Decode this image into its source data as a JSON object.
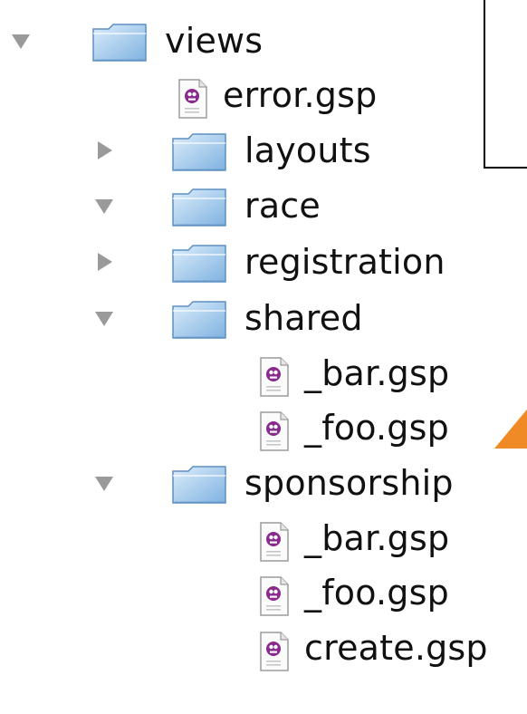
{
  "colors": {
    "folder_light": "#dcedfb",
    "folder_dark": "#7fb2e0",
    "folder_stroke": "#5d8fc2",
    "disclosure": "#9a9a9a",
    "file_badge": "#8a2a8e",
    "callout_pointer": "#f08a24"
  },
  "tree": [
    {
      "label": "views",
      "kind": "folder",
      "expanded": true,
      "depth": 0
    },
    {
      "label": "error.gsp",
      "kind": "file",
      "depth": 1
    },
    {
      "label": "layouts",
      "kind": "folder",
      "expanded": false,
      "depth": 1
    },
    {
      "label": "race",
      "kind": "folder",
      "expanded": true,
      "depth": 1
    },
    {
      "label": "registration",
      "kind": "folder",
      "expanded": false,
      "depth": 1
    },
    {
      "label": "shared",
      "kind": "folder",
      "expanded": true,
      "depth": 1
    },
    {
      "label": "_bar.gsp",
      "kind": "file",
      "depth": 2
    },
    {
      "label": "_foo.gsp",
      "kind": "file",
      "depth": 2
    },
    {
      "label": "sponsorship",
      "kind": "folder",
      "expanded": true,
      "depth": 1
    },
    {
      "label": "_bar.gsp",
      "kind": "file",
      "depth": 2
    },
    {
      "label": "_foo.gsp",
      "kind": "file",
      "depth": 2
    },
    {
      "label": "create.gsp",
      "kind": "file",
      "depth": 2
    }
  ]
}
